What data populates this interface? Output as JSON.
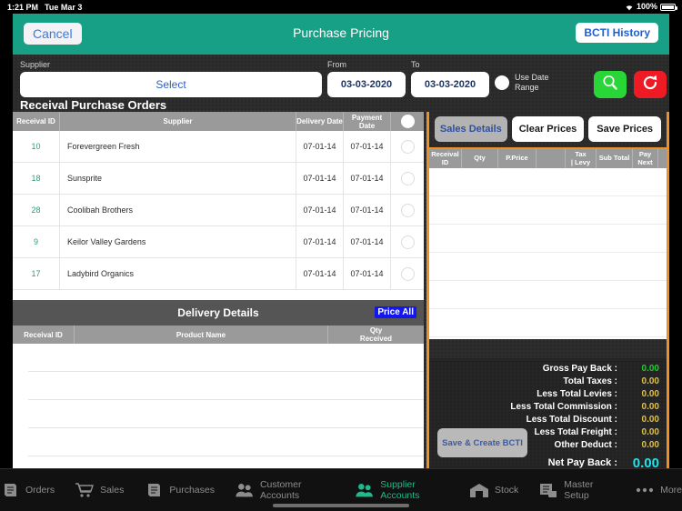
{
  "statusbar": {
    "time": "1:21 PM",
    "date": "Tue Mar 3",
    "battery": "100%"
  },
  "navbar": {
    "cancel_label": "Cancel",
    "title": "Purchase Pricing",
    "history_label": "BCTI History"
  },
  "filters": {
    "supplier_label": "Supplier",
    "supplier_value": "Select",
    "from_label": "From",
    "from_value": "03-03-2020",
    "to_label": "To",
    "to_value": "03-03-2020",
    "use_date_range_label": "Use Date Range",
    "search_icon": "search-icon",
    "reset_icon": "refresh-icon"
  },
  "purchase_orders": {
    "section_title": "Receival Purchase Orders",
    "columns": [
      "Receival ID",
      "Supplier",
      "Delivery Date",
      "Payment Date",
      ""
    ],
    "rows": [
      {
        "id": "10",
        "supplier": "Forevergreen Fresh",
        "delivery": "07-01-14",
        "payment": "07-01-14"
      },
      {
        "id": "18",
        "supplier": "Sunsprite",
        "delivery": "07-01-14",
        "payment": "07-01-14"
      },
      {
        "id": "28",
        "supplier": "Coolibah Brothers",
        "delivery": "07-01-14",
        "payment": "07-01-14"
      },
      {
        "id": "9",
        "supplier": "Keilor Valley Gardens",
        "delivery": "07-01-14",
        "payment": "07-01-14"
      },
      {
        "id": "17",
        "supplier": "Ladybird Organics",
        "delivery": "07-01-14",
        "payment": "07-01-14"
      }
    ]
  },
  "delivery_details": {
    "title": "Delivery Details",
    "price_all_label": "Price All",
    "columns": [
      "Receival ID",
      "Product Name",
      "Qty Received"
    ],
    "rows": []
  },
  "right_panel": {
    "tabs": [
      {
        "label": "Sales Details",
        "active": true
      },
      {
        "label": "Clear Prices",
        "active": false
      },
      {
        "label": "Save Prices",
        "active": false
      }
    ],
    "columns": [
      "Receival ID",
      "Qty",
      "P.Price",
      "",
      "Tax | Levy",
      "Sub Total",
      "Pay Next",
      ""
    ],
    "rows": []
  },
  "totals": {
    "save_bcti_label": "Save & Create BCTI",
    "lines": [
      {
        "label": "Gross Pay Back :",
        "value": "0.00",
        "color": "green"
      },
      {
        "label": "Total Taxes :",
        "value": "0.00",
        "color": "gold"
      },
      {
        "label": "Less Total Levies :",
        "value": "0.00",
        "color": "gold"
      },
      {
        "label": "Less Total Commission :",
        "value": "0.00",
        "color": "gold"
      },
      {
        "label": "Less Total Discount :",
        "value": "0.00",
        "color": "gold"
      },
      {
        "label": "Less Total Freight :",
        "value": "0.00",
        "color": "gold"
      },
      {
        "label": "Other Deduct :",
        "value": "0.00",
        "color": "gold"
      }
    ],
    "net_label": "Net Pay Back :",
    "net_value": "0.00"
  },
  "tabbar": {
    "items": [
      {
        "label": "Orders",
        "icon": "orders-icon",
        "active": false
      },
      {
        "label": "Sales",
        "icon": "cart-icon",
        "active": false
      },
      {
        "label": "Purchases",
        "icon": "invoice-icon",
        "active": false
      },
      {
        "label": "Customer Accounts",
        "icon": "people-icon",
        "active": false
      },
      {
        "label": "Supplier Accounts",
        "icon": "people-icon",
        "active": true
      },
      {
        "label": "Stock",
        "icon": "warehouse-icon",
        "active": false
      },
      {
        "label": "Master Setup",
        "icon": "settings-icon",
        "active": false
      },
      {
        "label": "More",
        "icon": "ellipsis-icon",
        "active": false
      }
    ]
  },
  "colors": {
    "nav": "#17a085",
    "accent_orange": "#f09020",
    "search_green": "#28d637",
    "reset_red": "#ee1b24",
    "net_cyan": "#1fe4ea"
  }
}
